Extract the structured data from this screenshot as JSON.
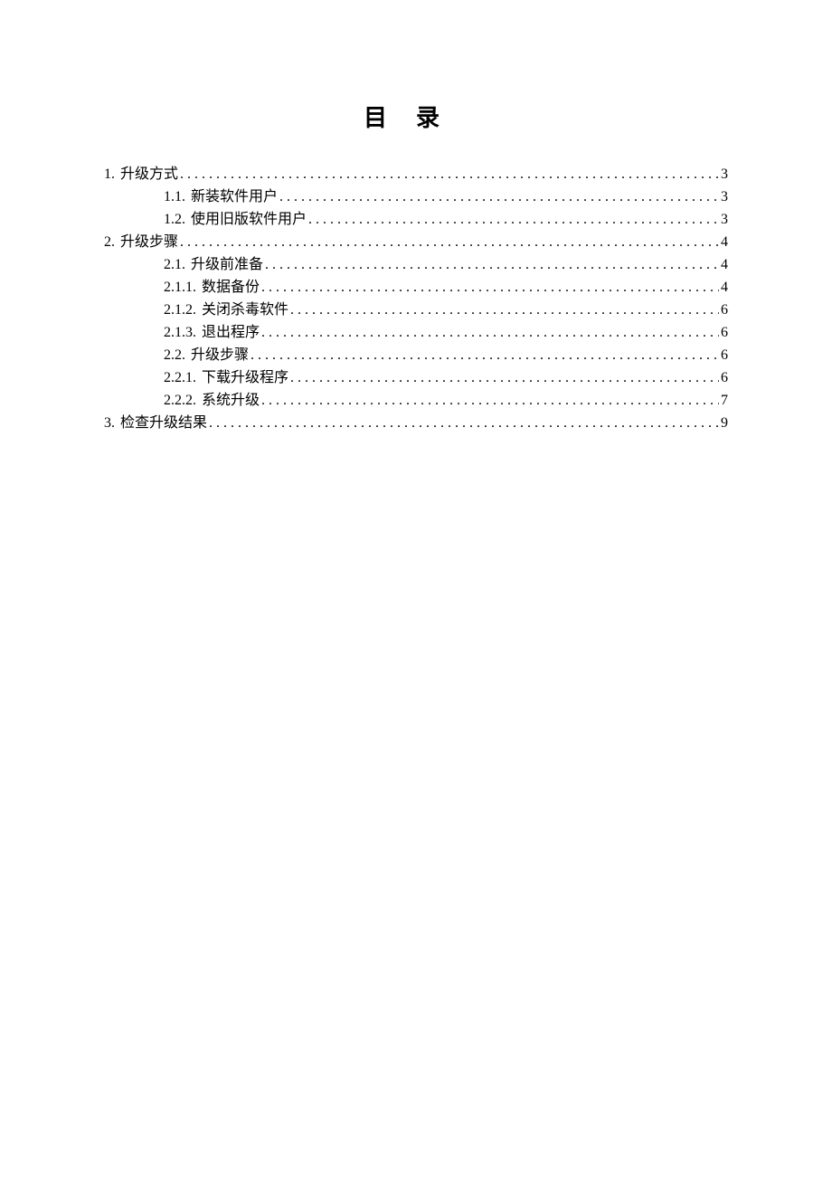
{
  "title": "目录",
  "toc": [
    {
      "level": 1,
      "num": "1",
      "text": "升级方式",
      "page": "3"
    },
    {
      "level": 2,
      "num": "1.1",
      "text": "新装软件用户",
      "page": "3"
    },
    {
      "level": 2,
      "num": "1.2",
      "text": "使用旧版软件用户",
      "page": "3"
    },
    {
      "level": 1,
      "num": "2",
      "text": "升级步骤",
      "page": "4"
    },
    {
      "level": 2,
      "num": "2.1",
      "text": "升级前准备",
      "page": "4"
    },
    {
      "level": 3,
      "num": "2.1.1",
      "text": "数据备份",
      "page": "4"
    },
    {
      "level": 3,
      "num": "2.1.2",
      "text": "关闭杀毒软件",
      "page": "6"
    },
    {
      "level": 3,
      "num": "2.1.3",
      "text": "退出程序",
      "page": "6"
    },
    {
      "level": 2,
      "num": "2.2",
      "text": "升级步骤",
      "page": "6"
    },
    {
      "level": 3,
      "num": "2.2.1",
      "text": "下载升级程序",
      "page": "6"
    },
    {
      "level": 3,
      "num": "2.2.2",
      "text": "系统升级",
      "page": "7"
    },
    {
      "level": 1,
      "num": "3",
      "text": "检查升级结果",
      "page": "9"
    }
  ]
}
